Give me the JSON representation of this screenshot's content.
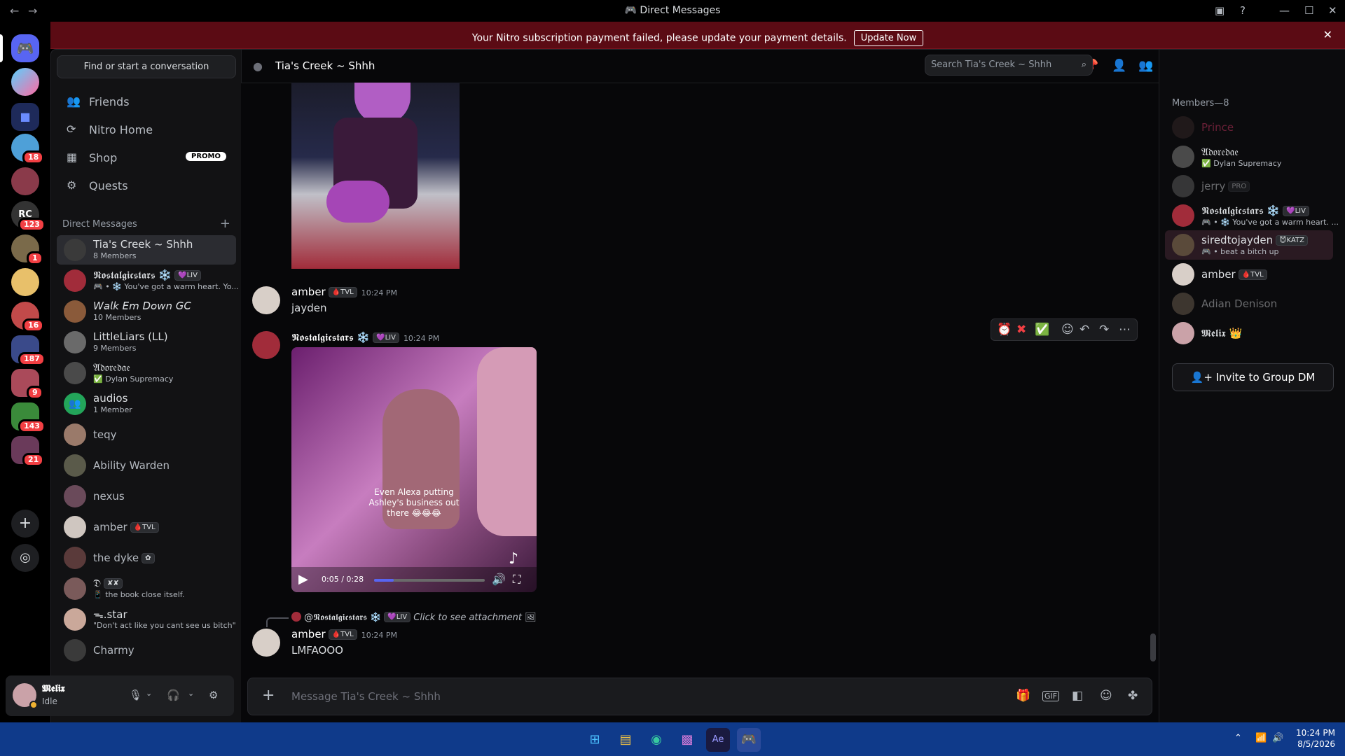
{
  "window": {
    "title": "Direct Messages"
  },
  "banner": {
    "message": "Your Nitro subscription payment failed, please update your payment details.",
    "button": "Update Now"
  },
  "rail": {
    "badges": [
      "18",
      "123",
      "1",
      "16",
      "187",
      "9",
      "143",
      "21"
    ]
  },
  "dm_sidebar": {
    "find_placeholder": "Find or start a conversation",
    "nav": [
      {
        "label": "Friends",
        "icon": "friends-icon"
      },
      {
        "label": "Nitro Home",
        "icon": "nitro-icon"
      },
      {
        "label": "Shop",
        "icon": "shop-icon",
        "badge": "PROMO"
      },
      {
        "label": "Quests",
        "icon": "quests-icon"
      }
    ],
    "section_title": "Direct Messages",
    "items": [
      {
        "name": "Tia's Creek ~ Shhh",
        "sub": "8 Members"
      },
      {
        "name": "𝕹𝖔𝖘𝖙𝖆𝖑𝖌𝖎𝖈𝖘𝖙𝖆𝖗𝖘 ❄️",
        "tag": "💜LIV",
        "sub": "🎮 • ❄️ You've got a warm heart. Yo..."
      },
      {
        "name": "𝘞𝘢𝘭𝘬 𝘌𝘮 𝘋𝘰𝘸𝘯 𝘎𝘊",
        "sub": "10 Members"
      },
      {
        "name": "LittleLiars (LL)",
        "sub": "9 Members"
      },
      {
        "name": "𝔄𝔡𝔬𝔯𝔢𝔡𝔞𝔢",
        "sub": "✅ Dylan Supremacy"
      },
      {
        "name": "audios",
        "sub": "1 Member"
      },
      {
        "name": "teqy"
      },
      {
        "name": "Ability Warden"
      },
      {
        "name": "nexus"
      },
      {
        "name": "amber",
        "tag": "🩸TVL"
      },
      {
        "name": "the dyke",
        "tag": "✿"
      },
      {
        "name": "𝔇",
        "tag": "✘✘",
        "sub": "📱 the book close itself."
      },
      {
        "name": "ᯓ.star",
        "sub": "\"Don't act like you cant see us bitch\""
      },
      {
        "name": "Charmy"
      }
    ]
  },
  "user": {
    "name": "𝕸𝖊𝖑𝖎𝖝",
    "status": "Idle"
  },
  "channel": {
    "name": "Tia's Creek ~ Shhh",
    "search_placeholder": "Search Tia's Creek ~ Shhh"
  },
  "messages": [
    {
      "author": "amber",
      "tag": "🩸TVL",
      "time": "10:24 PM",
      "text": "jayden"
    },
    {
      "author": "𝕹𝖔𝖘𝖙𝖆𝖑𝖌𝖎𝖈𝖘𝖙𝖆𝖗𝖘 ❄️",
      "tag": "💜LIV",
      "time": "10:24 PM",
      "video": {
        "caption": "Even Alexa putting Ashley's business out there 😂😂😂",
        "time": "0:05 / 0:28",
        "progress": 0.18
      }
    },
    {
      "reply": {
        "author": "@𝕹𝖔𝖘𝖙𝖆𝖑𝖌𝖎𝖈𝖘𝖙𝖆𝖗𝖘 ❄️",
        "tag": "💜LIV",
        "text": "Click to see attachment"
      },
      "author": "amber",
      "tag": "🩸TVL",
      "time": "10:24 PM",
      "text": "LMFAOOO"
    }
  ],
  "composer": {
    "placeholder": "Message Tia's Creek ~ Shhh"
  },
  "members": {
    "header": "Members—8",
    "list": [
      {
        "name": "Prince"
      },
      {
        "name": "𝔄𝔡𝔬𝔯𝔢𝔡𝔞𝔢",
        "sub": "✅ Dylan Supremacy"
      },
      {
        "name": "jerry",
        "tag": "PRO"
      },
      {
        "name": "𝕹𝖔𝖘𝖙𝖆𝖑𝖌𝖎𝖈𝖘𝖙𝖆𝖗𝖘 ❄️",
        "tag": "💜LIV",
        "sub": "🎮 • ❄️ You've got a warm heart. ..."
      },
      {
        "name": "siredtojayden",
        "tag": "😈KATZ",
        "sub": "🎮 • beat a bitch up"
      },
      {
        "name": "amber",
        "tag": "🩸TVL"
      },
      {
        "name": "Adian Denison"
      },
      {
        "name": "𝕸𝖊𝖑𝖎𝖝",
        "tag": "👑"
      }
    ],
    "invite_button": "Invite to Group DM"
  },
  "taskbar": {
    "time": "10:24 PM",
    "date": "8/5/2026"
  },
  "colors": {
    "accent": "#5865f2",
    "danger": "#f23f43",
    "banner": "#5b0b14",
    "taskbar": "#0f3a8a"
  }
}
